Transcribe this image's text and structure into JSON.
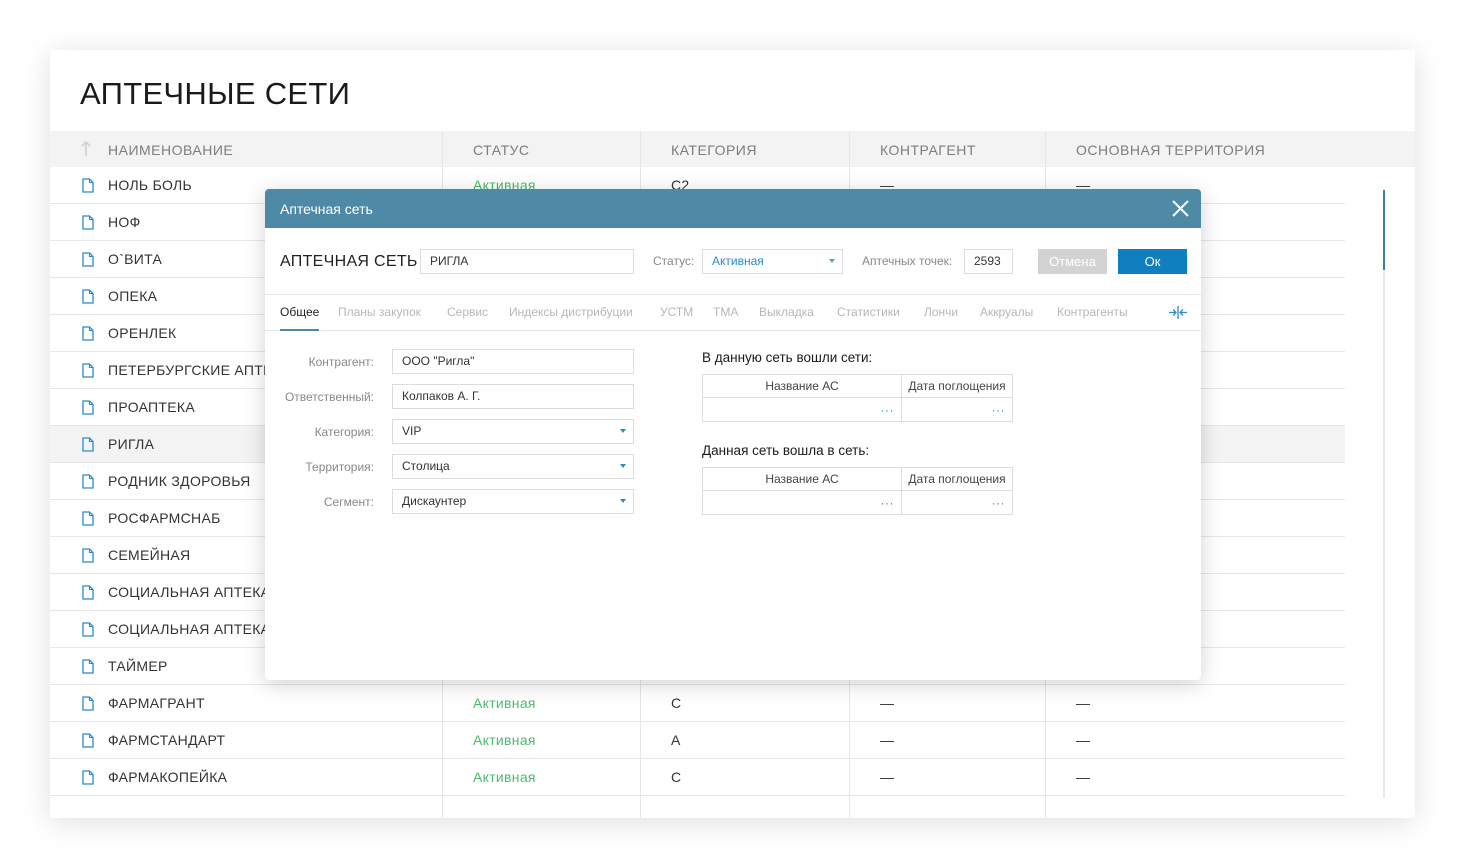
{
  "page": {
    "title": "АПТЕЧНЫЕ СЕТИ"
  },
  "table": {
    "headers": [
      "НАИМЕНОВАНИЕ",
      "СТАТУС",
      "КАТЕГОРИЯ",
      "КОНТРАГЕНТ",
      "ОСНОВНАЯ ТЕРРИТОРИЯ"
    ],
    "rows": [
      {
        "name": "НОЛЬ БОЛЬ",
        "status": "Активная",
        "category": "C2",
        "counterparty": "—",
        "territory": "—"
      },
      {
        "name": "НОФ",
        "status": "",
        "category": "",
        "counterparty": "",
        "territory": ""
      },
      {
        "name": "О`ВИТА",
        "status": "",
        "category": "",
        "counterparty": "",
        "territory": ""
      },
      {
        "name": "ОПЕКА",
        "status": "",
        "category": "",
        "counterparty": "",
        "territory": ""
      },
      {
        "name": "ОРЕНЛЕК",
        "status": "",
        "category": "",
        "counterparty": "",
        "territory": ""
      },
      {
        "name": "ПЕТЕРБУРГСКИЕ АПТЕ",
        "status": "",
        "category": "",
        "counterparty": "",
        "territory": ""
      },
      {
        "name": "ПРОАПТЕКА",
        "status": "",
        "category": "",
        "counterparty": "",
        "territory": ""
      },
      {
        "name": "РИГЛА",
        "status": "",
        "category": "",
        "counterparty": "",
        "territory": ""
      },
      {
        "name": "РОДНИК ЗДОРОВЬЯ",
        "status": "",
        "category": "",
        "counterparty": "",
        "territory": ""
      },
      {
        "name": "РОСФАРМСНАБ",
        "status": "",
        "category": "",
        "counterparty": "",
        "territory": ""
      },
      {
        "name": "СЕМЕЙНАЯ",
        "status": "",
        "category": "",
        "counterparty": "",
        "territory": ""
      },
      {
        "name": "СОЦИАЛЬНАЯ АПТЕКА",
        "status": "",
        "category": "",
        "counterparty": "",
        "territory": ""
      },
      {
        "name": "СОЦИАЛЬНАЯ АПТЕКА",
        "status": "",
        "category": "",
        "counterparty": "",
        "territory": ""
      },
      {
        "name": "ТАЙМЕР",
        "status": "",
        "category": "",
        "counterparty": "",
        "territory": ""
      },
      {
        "name": "ФАРМАГРАНТ",
        "status": "Активная",
        "category": "С",
        "counterparty": "—",
        "territory": "—"
      },
      {
        "name": "ФАРМСТАНДАРТ",
        "status": "Активная",
        "category": "А",
        "counterparty": "—",
        "territory": "—"
      },
      {
        "name": "ФАРМАКОПЕЙКА",
        "status": "Активная",
        "category": "С",
        "counterparty": "—",
        "territory": "—"
      }
    ]
  },
  "modal": {
    "header": "Аптечная сеть",
    "title": "АПТЕЧНАЯ СЕТЬ",
    "name_value": "РИГЛА",
    "status_label": "Статус:",
    "status_value": "Активная",
    "points_label": "Аптечных точек:",
    "points_value": "2593",
    "cancel_label": "Отмена",
    "ok_label": "Ок",
    "tabs": [
      "Общее",
      "Планы закупок",
      "Сервис",
      "Индексы дистрибуции",
      "УСТМ",
      "ТМА",
      "Выкладка",
      "Статистики",
      "Лончи",
      "Аккруалы",
      "Контрагенты"
    ],
    "fields": [
      {
        "label": "Контрагент:",
        "value": "ООО \"Ригла\""
      },
      {
        "label": "Ответственный:",
        "value": "Колпаков А. Г."
      },
      {
        "label": "Категория:",
        "value": "VIP"
      },
      {
        "label": "Территория:",
        "value": "Столица"
      },
      {
        "label": "Сегмент:",
        "value": "Дискаунтер"
      }
    ],
    "merged_in_title": "В данную сеть вошли сети:",
    "merged_into_title": "Данная сеть вошла в сеть:",
    "col_name": "Название АС",
    "col_date": "Дата поглощения",
    "dots": "···"
  },
  "colors": {
    "header_bg": "#4e8aa6",
    "ok_button": "#0f7fc0",
    "cancel_button": "#d3d3d3",
    "status_active": "#4cbb6c"
  }
}
